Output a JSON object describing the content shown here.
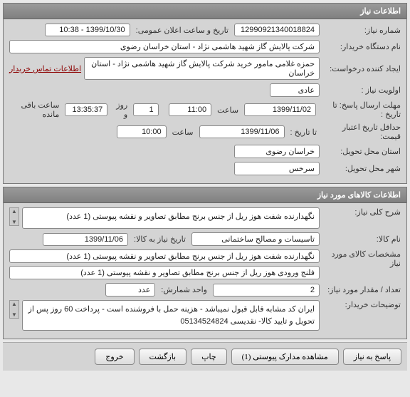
{
  "panel1": {
    "title": "اطلاعات نیاز",
    "need_number_label": "شماره نیاز:",
    "need_number": "12990921340018824",
    "announce_label": "تاریخ و ساعت اعلان عمومی:",
    "announce_value": "1399/10/30 - 10:38",
    "buyer_org_label": "نام دستگاه خریدار:",
    "buyer_org": "شرکت پالایش گاز شهید هاشمی نژاد - استان خراسان رضوی",
    "requester_label": "ایجاد کننده درخواست:",
    "requester": "حمزه غلامی مامور خرید شرکت پالایش گاز شهید هاشمی نژاد - استان خراسان",
    "contact_link": "اطلاعات تماس خریدار",
    "priority_label": "اولویت نیاز :",
    "priority": "عادی",
    "deadline_label": "مهلت ارسال پاسخ:  تا تاریخ :",
    "deadline_date": "1399/11/02",
    "time_label": "ساعت",
    "deadline_time": "11:00",
    "days_left": "1",
    "days_left_label": "روز و",
    "hours_left": "13:35:37",
    "hours_left_label": "ساعت باقی مانده",
    "credit_label": "حداقل تاریخ اعتبار قیمت:",
    "credit_to_label": "تا تاریخ :",
    "credit_date": "1399/11/06",
    "credit_time": "10:00",
    "delivery_province_label": "استان محل تحویل:",
    "delivery_province": "خراسان رضوی",
    "delivery_city_label": "شهر محل تحویل:",
    "delivery_city": "سرخس"
  },
  "panel2": {
    "title": "اطلاعات کالاهای مورد نیاز",
    "general_desc_label": "شرح کلی نیاز:",
    "general_desc": "نگهدارنده شفت هوز ریل از جنس برنج مطابق  تصاویر و نقشه پیوستی  (1 عدد)",
    "goods_name_label": "نام کالا:",
    "goods_name": "تاسیسات و مصالح ساختمانی",
    "goods_date_label": "تاریخ نیاز به کالا:",
    "goods_date": "1399/11/06",
    "specs_label": "مشخصات کالای مورد نیاز",
    "specs_line1": "نگهدارنده شفت هوز ریل از جنس برنج مطابق  تصاویر و نقشه پیوستی  (1 عدد)",
    "specs_line2": "فلنج ورودی هوز ریل از جنس برنج مطابق تصاویر و نقشه پیوستی (1 عدد)",
    "qty_label": "تعداد / مقدار مورد نیاز:",
    "qty": "2",
    "unit_label": "واحد شمارش:",
    "unit": "عدد",
    "buyer_notes_label": "توضیحات خریدار:",
    "buyer_notes": "ایران کد مشابه قابل قبول نمیباشد - هزینه حمل با فروشنده است - پرداخت 60 روز پس از تحویل و تایید کالا- نقدیسی 05134524824"
  },
  "buttons": {
    "respond": "پاسخ به نیاز",
    "view_attachments": "مشاهده مدارک پیوستی (1)",
    "print": "چاپ",
    "back": "بازگشت",
    "exit": "خروج"
  }
}
